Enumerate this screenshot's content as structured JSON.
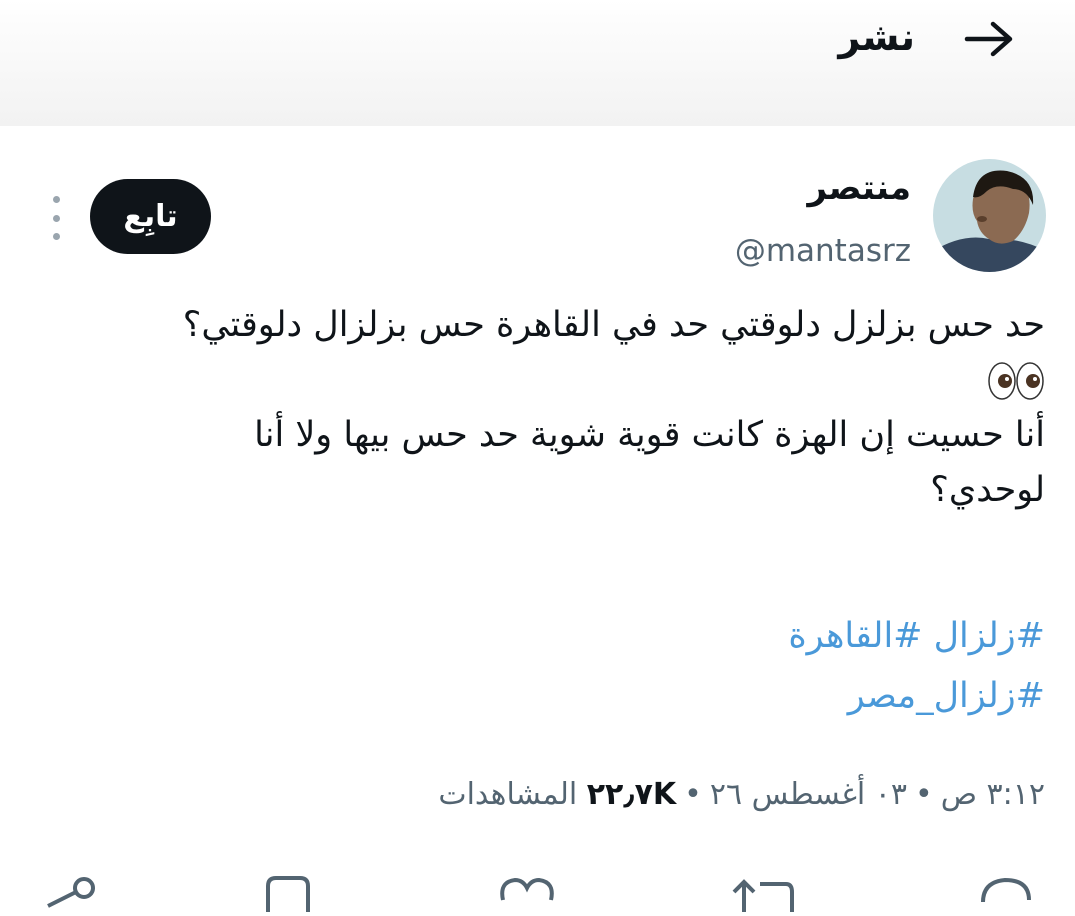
{
  "header": {
    "title": "نشر",
    "back_icon": "arrow-right-icon"
  },
  "author": {
    "display_name": "منتصر",
    "handle": "@mantasrz",
    "avatar_icon": "profile-photo"
  },
  "follow_label": "تابِع",
  "more_icon": "more-vertical-icon",
  "tweet": {
    "line1": "حد حس بزلزل دلوقتي حد في القاهرة حس بزلزال دلوقتي؟",
    "emoji": "eyes-emoji",
    "line2": "أنا حسيت إن الهزة كانت قوية شوية حد حس بيها ولا أنا",
    "line3": "لوحدي؟",
    "hashtags": [
      "#زلزال #القاهرة",
      "#زلزال_مصر"
    ]
  },
  "meta": {
    "time": "٣:١٢ ص",
    "date": "٠٣ أغسطس ٢٦",
    "views_count": "٢٢٫٧K",
    "views_label": "المشاهدات"
  },
  "colors": {
    "text": "#0f1419",
    "secondary": "#536471",
    "hashtag": "#4a99d9",
    "follow_bg": "#0f1419"
  }
}
